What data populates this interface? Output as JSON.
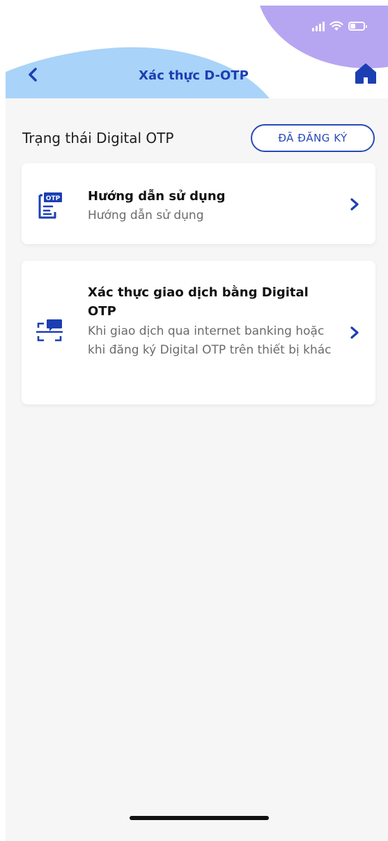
{
  "header": {
    "title": "Xác thực D-OTP",
    "back_icon": "chevron-left-icon",
    "home_icon": "home-icon"
  },
  "status_bar": {
    "icons": [
      "signal-icon",
      "wifi-icon",
      "battery-icon"
    ]
  },
  "otp_status": {
    "label": "Trạng thái Digital OTP",
    "badge": "ĐÃ ĐĂNG KÝ"
  },
  "menu": [
    {
      "icon": "otp-document-icon",
      "title": "Hướng dẫn sử dụng",
      "description": "Hướng dẫn sử dụng"
    },
    {
      "icon": "scan-message-icon",
      "title": "Xác thực giao dịch bằng Digital OTP",
      "description": "Khi giao dịch qua internet banking hoặc khi đăng ký Digital OTP trên thiết bị khác"
    }
  ],
  "colors": {
    "primary": "#1b3fb3",
    "header_blue": "#a9d3f8",
    "header_purple": "#b6a6f1",
    "background": "#f6f6f6"
  }
}
